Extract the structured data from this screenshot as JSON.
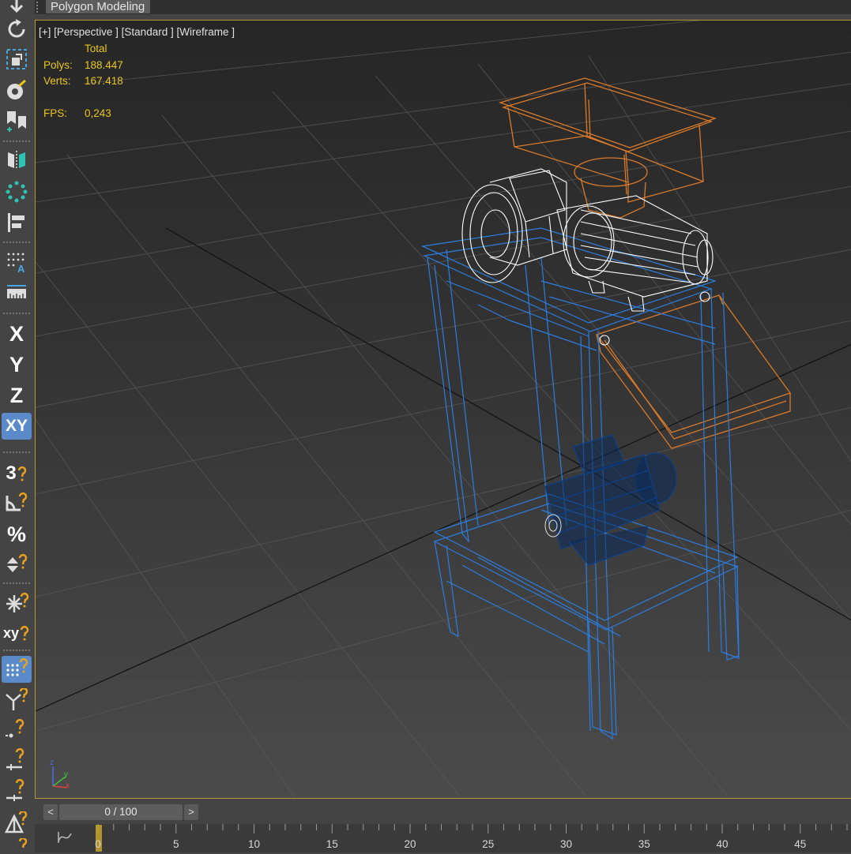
{
  "ribbon": {
    "active_tab": "Polygon Modeling"
  },
  "viewport": {
    "label": "[+] [Perspective ] [Standard ] [Wireframe ]",
    "stats": {
      "header": "Total",
      "polys_label": "Polys:",
      "polys_value": "188.447",
      "verts_label": "Verts:",
      "verts_value": "167.418",
      "fps_label": "FPS:",
      "fps_value": "0,243"
    },
    "axis_tripod": {
      "z": "z",
      "y": "y",
      "x": "x"
    }
  },
  "toolbar": {
    "items": [
      {
        "name": "move-icon"
      },
      {
        "name": "rotate-icon"
      },
      {
        "name": "scale-icon"
      },
      {
        "name": "place-icon"
      },
      {
        "name": "mirror-icon"
      },
      {
        "name": "align-icon"
      },
      {
        "name": "ring-icon"
      },
      {
        "name": "layer-icon"
      },
      {
        "name": "dot-grid-icon"
      },
      {
        "name": "measure-icon"
      }
    ],
    "axis_x": "X",
    "axis_y": "Y",
    "axis_z": "Z",
    "axis_xy": "XY",
    "snap_3": "3",
    "percent": "%",
    "snap_xy": "xy"
  },
  "timeline": {
    "prev_label": "<",
    "next_label": ">",
    "frame_display": "0 / 100",
    "curve_icon": "curve-editor-icon",
    "ticks": [
      "0",
      "5",
      "10",
      "15",
      "20",
      "25",
      "30",
      "35",
      "40",
      "45"
    ]
  },
  "colors": {
    "stats_yellow": "#e9c61d",
    "viewport_border": "#b7953a",
    "wire_orange": "#d97a2a",
    "wire_blue": "#2b7de0",
    "wire_white": "#ffffff",
    "active_blue": "#5a8ac8"
  }
}
